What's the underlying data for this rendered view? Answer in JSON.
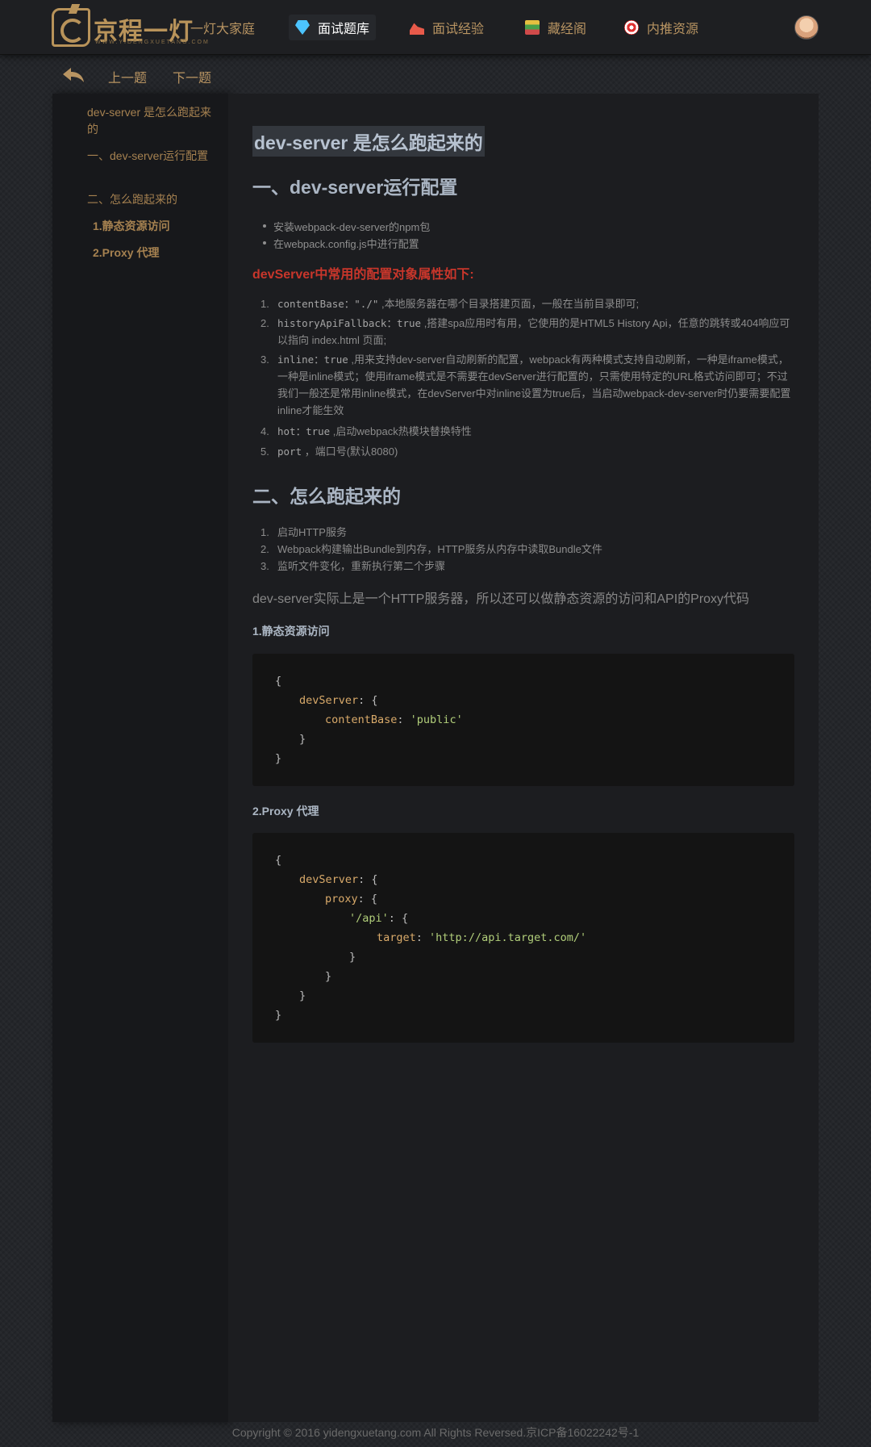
{
  "header": {
    "logo_text": "京程一灯",
    "logo_sub": "WWW.YIDENGXUETANG.COM",
    "nav": [
      {
        "label": "一灯大家庭",
        "icon": "none",
        "active": false
      },
      {
        "label": "面试题库",
        "icon": "diamond-icon",
        "active": true
      },
      {
        "label": "面试经验",
        "icon": "shoe-icon",
        "active": false
      },
      {
        "label": "藏经阁",
        "icon": "books-icon",
        "active": false
      },
      {
        "label": "内推资源",
        "icon": "target-icon",
        "active": false
      }
    ]
  },
  "toolbar": {
    "back_icon": "back-arrow-icon",
    "prev_label": "上一题",
    "next_label": "下一题"
  },
  "toc": [
    {
      "label": "dev-server 是怎么跑起来的",
      "level": 1
    },
    {
      "label": "一、dev-server运行配置",
      "level": 1
    },
    {
      "label": "二、怎么跑起来的",
      "level": 1
    },
    {
      "label": "1.静态资源访问",
      "level": 2
    },
    {
      "label": "2.Proxy 代理",
      "level": 2
    }
  ],
  "article": {
    "title": "dev-server 是怎么跑起来的",
    "section1_title": "一、dev-server运行配置",
    "bullets": [
      "安装webpack-dev-server的npm包",
      "在webpack.config.js中进行配置"
    ],
    "red_heading": "devServer中常用的配置对象属性如下:",
    "config_items": [
      {
        "num": "1.",
        "code": "contentBase：\"./\"",
        "text": " ,本地服务器在哪个目录搭建页面，一般在当前目录即可;"
      },
      {
        "num": "2.",
        "code": "historyApiFallback：true",
        "text": " ,搭建spa应用时有用，它使用的是HTML5 History Api，任意的跳转或404响应可以指向 index.html 页面;"
      },
      {
        "num": "3.",
        "code": "inline：true",
        "text": " ,用来支持dev-server自动刷新的配置，webpack有两种模式支持自动刷新，一种是iframe模式，一种是inline模式；使用iframe模式是不需要在devServer进行配置的，只需使用特定的URL格式访问即可；不过我们一般还是常用inline模式，在devServer中对inline设置为true后，当启动webpack-dev-server时仍要需要配置inline才能生效"
      },
      {
        "num": "4.",
        "code": "hot：true",
        "text": " ,启动webpack热模块替换特性"
      },
      {
        "num": "5.",
        "code": "port",
        "text": " ，端口号(默认8080)"
      }
    ],
    "section2_title": "二、怎么跑起来的",
    "steps": [
      {
        "num": "1.",
        "text": "启动HTTP服务"
      },
      {
        "num": "2.",
        "text": "Webpack构建输出Bundle到内存，HTTP服务从内存中读取Bundle文件"
      },
      {
        "num": "3.",
        "text": "监听文件变化，重新执行第二个步骤"
      }
    ],
    "summary": "dev-server实际上是一个HTTP服务器，所以还可以做静态资源的访问和API的Proxy代码",
    "static_title": "1.静态资源访问",
    "code1": {
      "open": "{",
      "devServer": "devServer",
      "colon_brace": ": {",
      "contentBase": "contentBase",
      "colon": ": ",
      "public": "'public'",
      "close_inner": "}",
      "close": "}"
    },
    "proxy_title": "2.Proxy 代理",
    "code2": {
      "open": "{",
      "devServer": "devServer",
      "colon_brace": ": {",
      "proxy": "proxy",
      "api": "'/api'",
      "target": "target",
      "colon": ": ",
      "url": "'http://api.target.com/'",
      "close": "}"
    }
  },
  "footer": "Copyright © 2016 yidengxuetang.com All Rights Reversed.京ICP备16022242号-1",
  "colors": {
    "accent": "#b89462",
    "red_heading": "#c8362b",
    "code_key": "#d9aa6a",
    "code_string": "#b1ce7a"
  }
}
